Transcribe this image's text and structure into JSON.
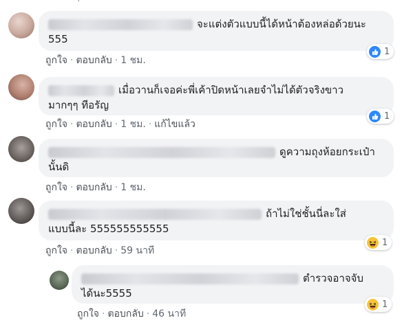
{
  "comments": [
    {
      "text_line1": "จะแต่งตัวแบบนี้ได้หน้าต้องหล่อด้วยนะ",
      "text_line2": "555",
      "actions": {
        "like": "ถูกใจ",
        "reply": "ตอบกลับ",
        "time": "1 ชม."
      },
      "reaction": {
        "type": "like",
        "count": "1"
      }
    },
    {
      "text_line1": "เมื่อวานก็เจอค่ะพี่เค้าปิดหน้าเลยจำไม่ได้ตัวจริงขาว",
      "text_line2": "มากๆๆ ทีอรัญ",
      "actions": {
        "like": "ถูกใจ",
        "reply": "ตอบกลับ",
        "time": "1 ชม.",
        "edited": "แก้ไขแล้ว"
      },
      "reaction": {
        "type": "like",
        "count": "1"
      }
    },
    {
      "text_line1": "ดูความถุงห้อยกระเป๋า",
      "text_line2": "นั้นดิ",
      "actions": {
        "like": "ถูกใจ",
        "reply": "ตอบกลับ",
        "time": "1 ชม."
      }
    },
    {
      "text_line1": "ถ้าไม่ใช่ชั้นนี่ละใส่",
      "text_line2": "แบบนี้ละ 555555555555",
      "actions": {
        "like": "ถูกใจ",
        "reply": "ตอบกลับ",
        "time": "59 นาที"
      },
      "reaction": {
        "type": "haha",
        "count": "1"
      }
    },
    {
      "text_line1": "ตำรวจอาจจับ",
      "text_line2": "ได้นะ5555",
      "actions": {
        "like": "ถูกใจ",
        "reply": "ตอบกลับ",
        "time": "46 นาที"
      },
      "reaction": {
        "type": "haha",
        "count": "1"
      }
    }
  ],
  "colors": {
    "bubble": "#f2f3f5",
    "like": "#2d88ff",
    "haha": "#f7c33b",
    "meta": "#606770"
  }
}
